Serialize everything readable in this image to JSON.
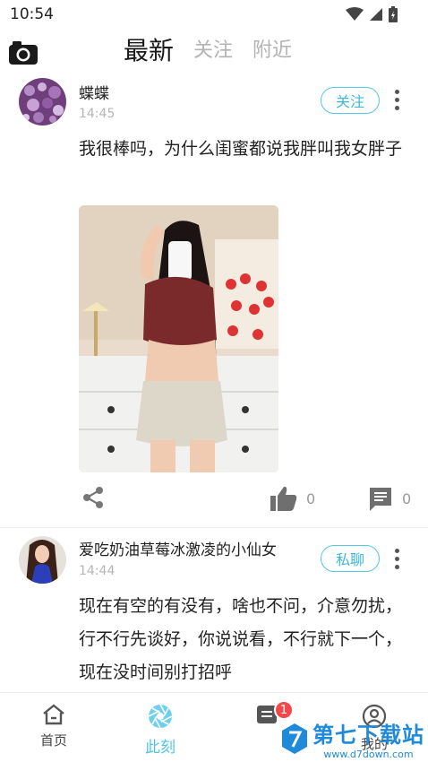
{
  "status_bar": {
    "time": "10:54"
  },
  "top_tabs": [
    {
      "label": "最新",
      "active": true
    },
    {
      "label": "关注",
      "active": false
    },
    {
      "label": "附近",
      "active": false
    }
  ],
  "posts": [
    {
      "username": "蝶蝶",
      "time": "14:45",
      "action_label": "关注",
      "text": "我很棒吗，为什么闺蜜都说我胖叫我女胖子",
      "likes": "0",
      "comments": "0"
    },
    {
      "username": "爱吃奶油草莓冰激凌的小仙女",
      "time": "14:44",
      "action_label": "私聊",
      "text": "现在有空的有没有，啥也不问，介意勿扰，行不行先谈好，你说说看，不行就下一个，现在没时间别打招呼"
    }
  ],
  "bottom_nav": [
    {
      "label": "首页",
      "icon": "home-icon",
      "active": false
    },
    {
      "label": "此刻",
      "icon": "aperture-icon",
      "active": true
    },
    {
      "label": "",
      "icon": "message-icon",
      "active": false,
      "badge": "1"
    },
    {
      "label": "我的",
      "icon": "profile-icon",
      "active": false
    }
  ],
  "watermark": {
    "main": "第七下载站",
    "sub": "www.d7down.com"
  },
  "colors": {
    "accent": "#4fc3e6",
    "badge": "#f0484b",
    "text": "#222222",
    "muted": "#b5b5b5"
  }
}
